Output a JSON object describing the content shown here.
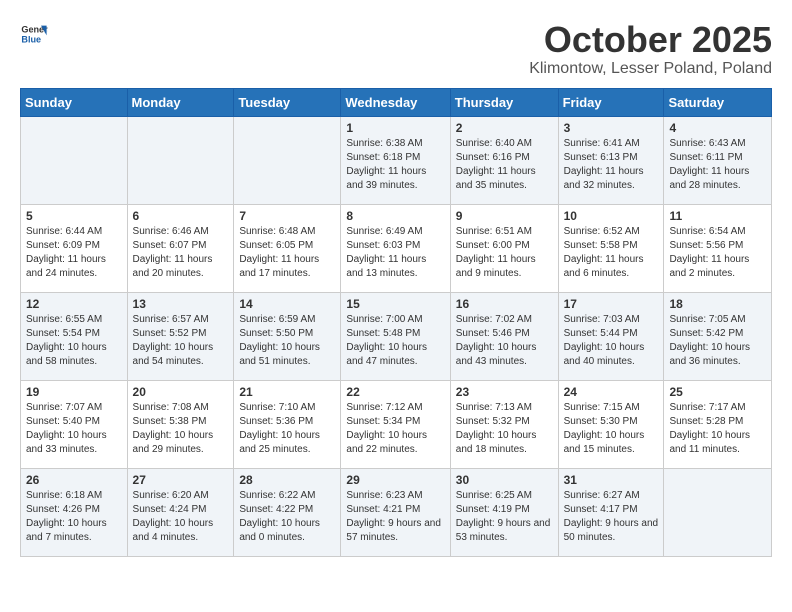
{
  "logo": {
    "line1": "General",
    "line2": "Blue"
  },
  "title": "October 2025",
  "subtitle": "Klimontow, Lesser Poland, Poland",
  "headers": [
    "Sunday",
    "Monday",
    "Tuesday",
    "Wednesday",
    "Thursday",
    "Friday",
    "Saturday"
  ],
  "weeks": [
    [
      {
        "day": "",
        "info": ""
      },
      {
        "day": "",
        "info": ""
      },
      {
        "day": "",
        "info": ""
      },
      {
        "day": "1",
        "info": "Sunrise: 6:38 AM\nSunset: 6:18 PM\nDaylight: 11 hours and 39 minutes."
      },
      {
        "day": "2",
        "info": "Sunrise: 6:40 AM\nSunset: 6:16 PM\nDaylight: 11 hours and 35 minutes."
      },
      {
        "day": "3",
        "info": "Sunrise: 6:41 AM\nSunset: 6:13 PM\nDaylight: 11 hours and 32 minutes."
      },
      {
        "day": "4",
        "info": "Sunrise: 6:43 AM\nSunset: 6:11 PM\nDaylight: 11 hours and 28 minutes."
      }
    ],
    [
      {
        "day": "5",
        "info": "Sunrise: 6:44 AM\nSunset: 6:09 PM\nDaylight: 11 hours and 24 minutes."
      },
      {
        "day": "6",
        "info": "Sunrise: 6:46 AM\nSunset: 6:07 PM\nDaylight: 11 hours and 20 minutes."
      },
      {
        "day": "7",
        "info": "Sunrise: 6:48 AM\nSunset: 6:05 PM\nDaylight: 11 hours and 17 minutes."
      },
      {
        "day": "8",
        "info": "Sunrise: 6:49 AM\nSunset: 6:03 PM\nDaylight: 11 hours and 13 minutes."
      },
      {
        "day": "9",
        "info": "Sunrise: 6:51 AM\nSunset: 6:00 PM\nDaylight: 11 hours and 9 minutes."
      },
      {
        "day": "10",
        "info": "Sunrise: 6:52 AM\nSunset: 5:58 PM\nDaylight: 11 hours and 6 minutes."
      },
      {
        "day": "11",
        "info": "Sunrise: 6:54 AM\nSunset: 5:56 PM\nDaylight: 11 hours and 2 minutes."
      }
    ],
    [
      {
        "day": "12",
        "info": "Sunrise: 6:55 AM\nSunset: 5:54 PM\nDaylight: 10 hours and 58 minutes."
      },
      {
        "day": "13",
        "info": "Sunrise: 6:57 AM\nSunset: 5:52 PM\nDaylight: 10 hours and 54 minutes."
      },
      {
        "day": "14",
        "info": "Sunrise: 6:59 AM\nSunset: 5:50 PM\nDaylight: 10 hours and 51 minutes."
      },
      {
        "day": "15",
        "info": "Sunrise: 7:00 AM\nSunset: 5:48 PM\nDaylight: 10 hours and 47 minutes."
      },
      {
        "day": "16",
        "info": "Sunrise: 7:02 AM\nSunset: 5:46 PM\nDaylight: 10 hours and 43 minutes."
      },
      {
        "day": "17",
        "info": "Sunrise: 7:03 AM\nSunset: 5:44 PM\nDaylight: 10 hours and 40 minutes."
      },
      {
        "day": "18",
        "info": "Sunrise: 7:05 AM\nSunset: 5:42 PM\nDaylight: 10 hours and 36 minutes."
      }
    ],
    [
      {
        "day": "19",
        "info": "Sunrise: 7:07 AM\nSunset: 5:40 PM\nDaylight: 10 hours and 33 minutes."
      },
      {
        "day": "20",
        "info": "Sunrise: 7:08 AM\nSunset: 5:38 PM\nDaylight: 10 hours and 29 minutes."
      },
      {
        "day": "21",
        "info": "Sunrise: 7:10 AM\nSunset: 5:36 PM\nDaylight: 10 hours and 25 minutes."
      },
      {
        "day": "22",
        "info": "Sunrise: 7:12 AM\nSunset: 5:34 PM\nDaylight: 10 hours and 22 minutes."
      },
      {
        "day": "23",
        "info": "Sunrise: 7:13 AM\nSunset: 5:32 PM\nDaylight: 10 hours and 18 minutes."
      },
      {
        "day": "24",
        "info": "Sunrise: 7:15 AM\nSunset: 5:30 PM\nDaylight: 10 hours and 15 minutes."
      },
      {
        "day": "25",
        "info": "Sunrise: 7:17 AM\nSunset: 5:28 PM\nDaylight: 10 hours and 11 minutes."
      }
    ],
    [
      {
        "day": "26",
        "info": "Sunrise: 6:18 AM\nSunset: 4:26 PM\nDaylight: 10 hours and 7 minutes."
      },
      {
        "day": "27",
        "info": "Sunrise: 6:20 AM\nSunset: 4:24 PM\nDaylight: 10 hours and 4 minutes."
      },
      {
        "day": "28",
        "info": "Sunrise: 6:22 AM\nSunset: 4:22 PM\nDaylight: 10 hours and 0 minutes."
      },
      {
        "day": "29",
        "info": "Sunrise: 6:23 AM\nSunset: 4:21 PM\nDaylight: 9 hours and 57 minutes."
      },
      {
        "day": "30",
        "info": "Sunrise: 6:25 AM\nSunset: 4:19 PM\nDaylight: 9 hours and 53 minutes."
      },
      {
        "day": "31",
        "info": "Sunrise: 6:27 AM\nSunset: 4:17 PM\nDaylight: 9 hours and 50 minutes."
      },
      {
        "day": "",
        "info": ""
      }
    ]
  ]
}
